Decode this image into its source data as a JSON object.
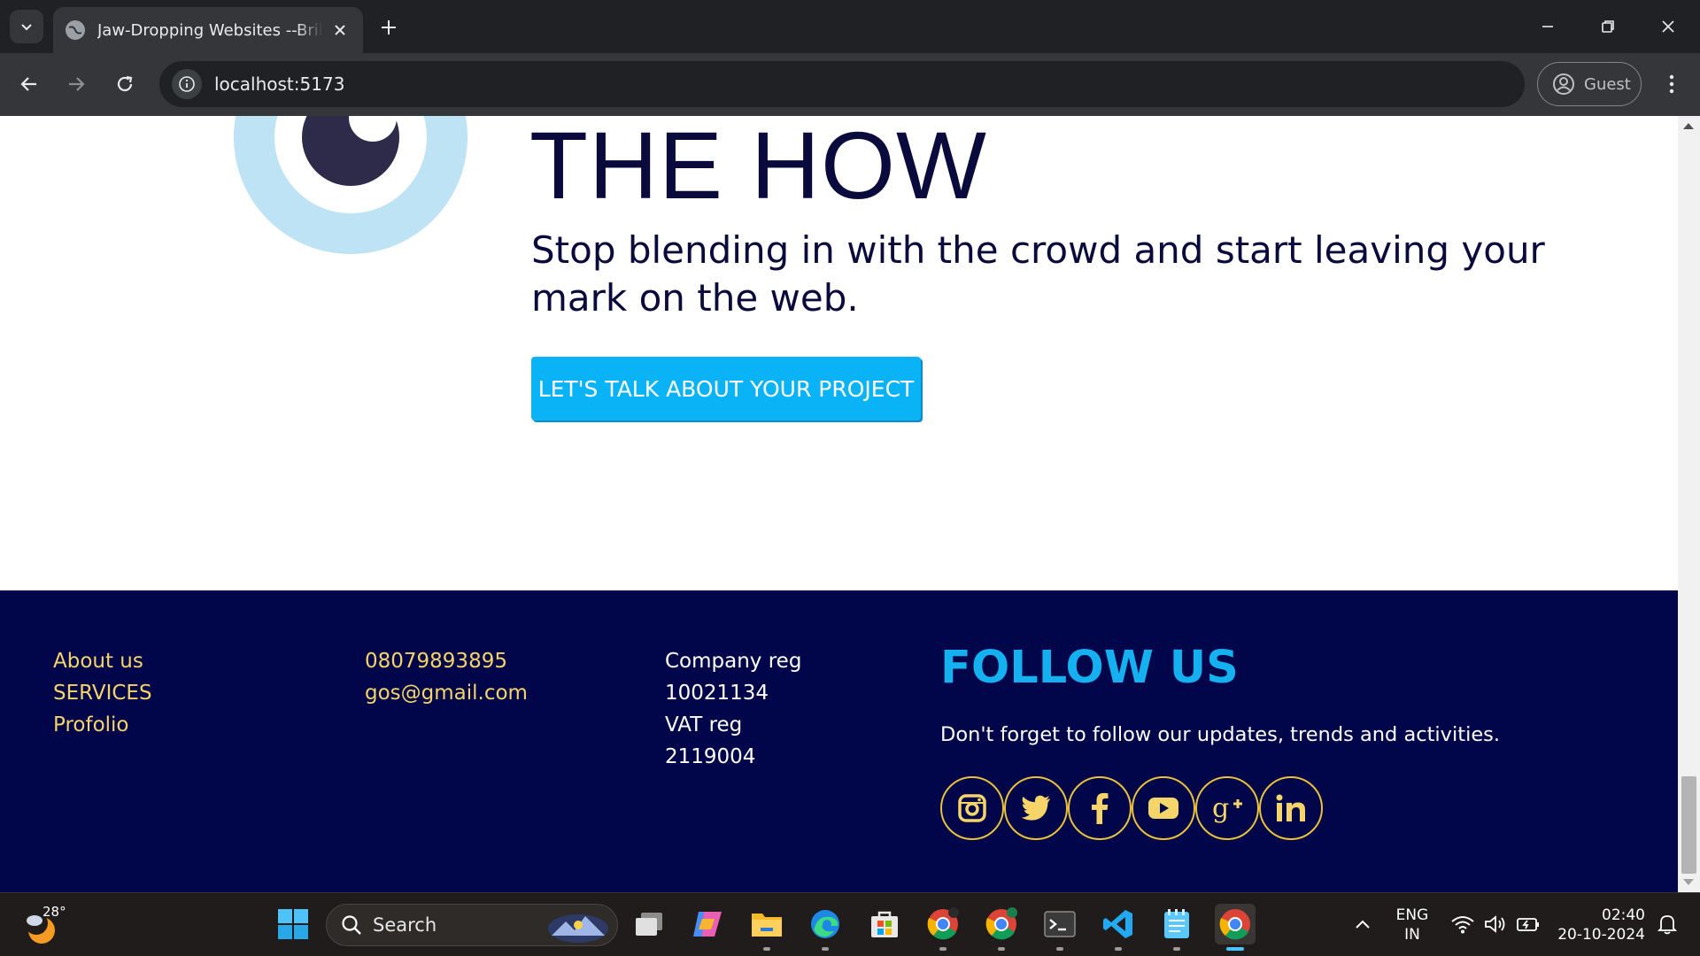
{
  "browser": {
    "tab_title": "Jaw-Dropping Websites --Brilweb",
    "url": "localhost:5173",
    "profile_label": "Guest"
  },
  "hero": {
    "title": "THE HOW",
    "subtitle": "Stop blending in with the crowd and start leaving your mark on the web.",
    "cta_label": "LET'S TALK ABOUT YOUR PROJECT"
  },
  "footer": {
    "links": [
      "About us",
      "SERVICES",
      "Profolio"
    ],
    "contact": [
      "08079893895",
      "gos@gmail.com"
    ],
    "company": [
      "Company reg",
      "10021134",
      "VAT reg",
      "2119004"
    ],
    "follow_title": "FOLLOW US",
    "follow_text": "Don't forget to follow our updates, trends and activities.",
    "socials": [
      "instagram-icon",
      "twitter-icon",
      "facebook-icon",
      "youtube-icon",
      "google-plus-icon",
      "linkedin-icon"
    ]
  },
  "taskbar": {
    "temperature": "28°",
    "search_label": "Search",
    "language": "ENG",
    "region": "IN",
    "time": "02:40",
    "date": "20-10-2024"
  },
  "colors": {
    "footer_bg": "#01054a",
    "link_yellow": "#f5d46a",
    "accent_blue": "#14b0f0",
    "cta_blue": "#0ab3f5",
    "heading_navy": "#0a0a3c"
  }
}
